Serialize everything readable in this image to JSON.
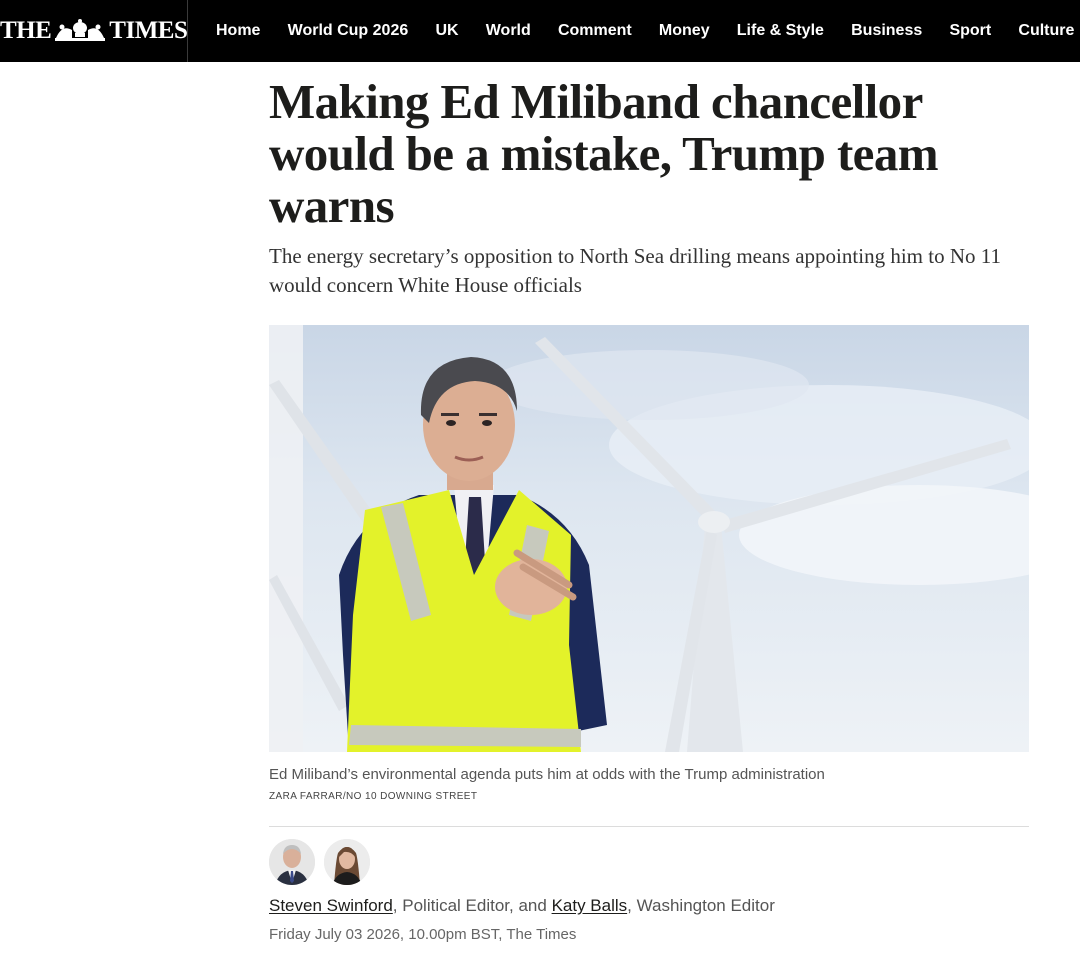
{
  "masthead": {
    "left": "THE",
    "right": "TIMES",
    "crest_icon": "royal-crest-icon"
  },
  "nav": [
    {
      "label": "Home"
    },
    {
      "label": "World Cup 2026"
    },
    {
      "label": "UK"
    },
    {
      "label": "World"
    },
    {
      "label": "Comment"
    },
    {
      "label": "Money"
    },
    {
      "label": "Life & Style"
    },
    {
      "label": "Business"
    },
    {
      "label": "Sport"
    },
    {
      "label": "Culture"
    }
  ],
  "article": {
    "headline": "Making Ed Miliband chancellor would be a mistake, Trump team warns",
    "standfirst": "The energy secretary’s opposition to North Sea drilling means appointing him to No 11 would concern White House officials",
    "image": {
      "caption": "Ed Miliband’s environmental agenda puts him at odds with the Trump administration",
      "credit": "ZARA FARRAR/NO 10 DOWNING STREET"
    },
    "authors": [
      {
        "name": "Steven Swinford",
        "role": ", Political Editor, and "
      },
      {
        "name": "Katy Balls",
        "role": ", Washington Editor"
      }
    ],
    "dateline": "Friday July 03 2026, 10.00pm BST, The Times"
  },
  "colors": {
    "nav_background": "#000000",
    "text": "#1d1d1b",
    "hi_vis_vest": "#e3f22a",
    "suit_navy": "#1c2a5a"
  }
}
